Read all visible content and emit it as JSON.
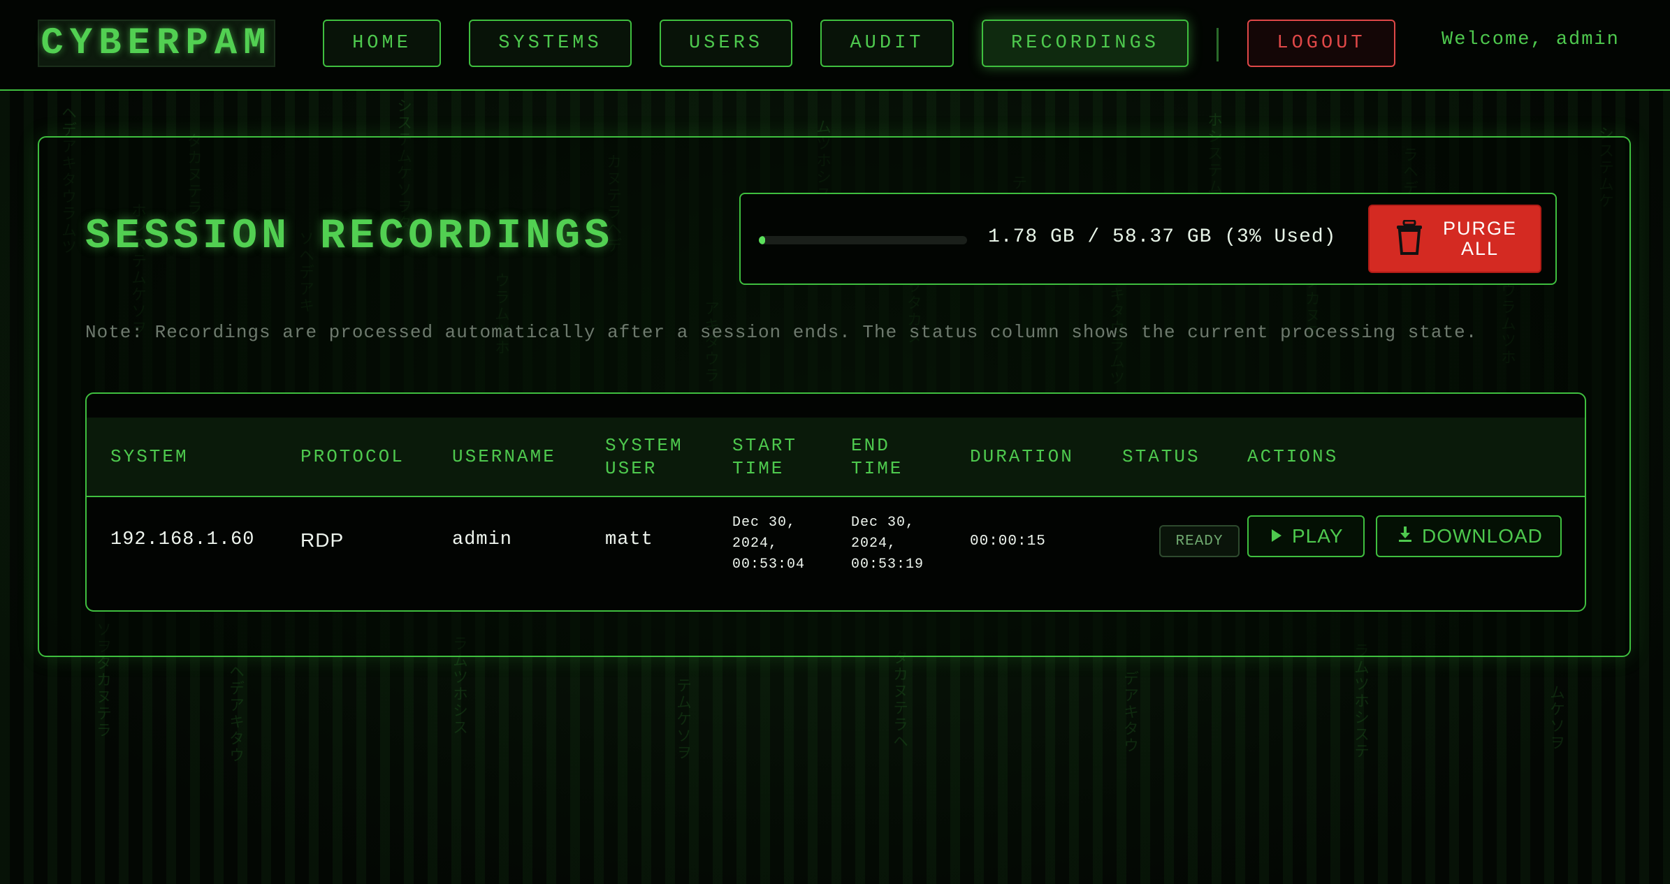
{
  "header": {
    "logo": "CYBERPAM",
    "nav": [
      {
        "label": "HOME"
      },
      {
        "label": "SYSTEMS"
      },
      {
        "label": "USERS"
      },
      {
        "label": "AUDIT"
      },
      {
        "label": "RECORDINGS"
      }
    ],
    "logout_label": "LOGOUT",
    "welcome": "Welcome, admin"
  },
  "page": {
    "title": "SESSION RECORDINGS",
    "storage": {
      "text": "1.78 GB / 58.37 GB (3% Used)",
      "used_fraction": 0.03
    },
    "purge_label": "PURGE ALL",
    "note": "Note: Recordings are processed automatically after a session ends. The status column shows the current processing state."
  },
  "table": {
    "headers": {
      "system": "SYSTEM",
      "protocol": "PROTOCOL",
      "username": "USERNAME",
      "system_user_1": "SYSTEM",
      "system_user_2": "USER",
      "start_1": "START",
      "start_2": "TIME",
      "end_1": "END",
      "end_2": "TIME",
      "duration": "DURATION",
      "status": "STATUS",
      "actions": "ACTIONS"
    },
    "rows": [
      {
        "system": "192.168.1.60",
        "protocol": "RDP",
        "username": "admin",
        "system_user": "matt",
        "start_1": "Dec 30,",
        "start_2": "2024,",
        "start_3": "00:53:04",
        "end_1": "Dec 30,",
        "end_2": "2024,",
        "end_3": "00:53:19",
        "duration": "00:00:15",
        "status": "READY",
        "play_label": "PLAY",
        "download_label": "DOWNLOAD"
      }
    ]
  },
  "colors": {
    "accent": "#4ec94e",
    "danger": "#d42a22",
    "background": "#040a04"
  },
  "background_text": "ヘデアキタウラムツホシステムケソヲタカヌテラ"
}
